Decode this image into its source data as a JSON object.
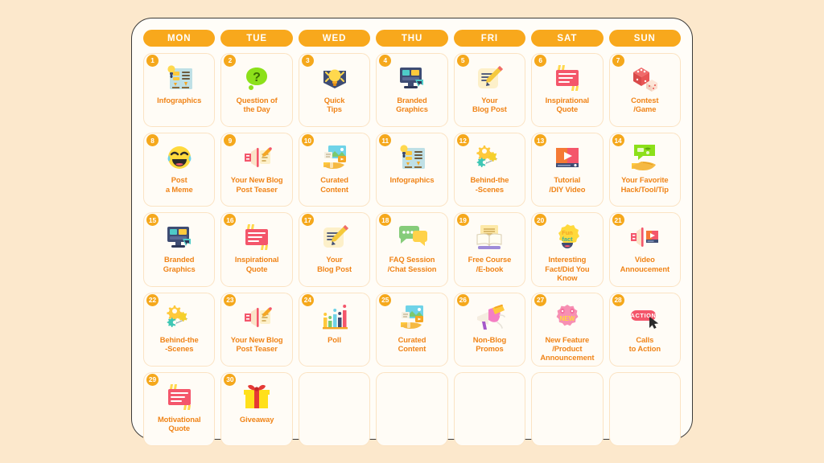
{
  "theme": {
    "page_background": "#FCE8CC",
    "panel_background": "#FFFDF8",
    "panel_border": "#3C3B39",
    "accent_orange": "#F8A81C",
    "label_orange": "#F08418",
    "cell_background": "#FFFCF6",
    "cell_border": "#FBE3C3",
    "badge_text": "#FFFFFF"
  },
  "header": {
    "days": [
      {
        "label": "MON"
      },
      {
        "label": "TUE"
      },
      {
        "label": "WED"
      },
      {
        "label": "THU"
      },
      {
        "label": "FRI"
      },
      {
        "label": "SAT"
      },
      {
        "label": "SUN"
      }
    ]
  },
  "calendar": {
    "rows": 5,
    "columns": 7,
    "total_filled": 30,
    "cells": [
      {
        "number": "1",
        "label": "Infographics",
        "icon": "infographic-board-icon",
        "empty": false
      },
      {
        "number": "2",
        "label": "Question of\nthe Day",
        "icon": "question-bubble-icon",
        "empty": false
      },
      {
        "number": "3",
        "label": "Quick\nTips",
        "icon": "lightbulb-banner-icon",
        "empty": false
      },
      {
        "number": "4",
        "label": "Branded\nGraphics",
        "icon": "desktop-monitor-icon",
        "empty": false
      },
      {
        "number": "5",
        "label": "Your\nBlog Post",
        "icon": "note-pencil-icon",
        "empty": false
      },
      {
        "number": "6",
        "label": "Inspirational\nQuote",
        "icon": "quote-card-icon",
        "empty": false
      },
      {
        "number": "7",
        "label": "Contest\n/Game",
        "icon": "dice-pair-icon",
        "empty": false
      },
      {
        "number": "8",
        "label": "Post\na Meme",
        "icon": "laughing-emoji-icon",
        "empty": false
      },
      {
        "number": "9",
        "label": "Your New Blog\nPost Teaser",
        "icon": "megaphone-note-icon",
        "empty": false
      },
      {
        "number": "10",
        "label": "Curated\nContent",
        "icon": "hand-media-icon",
        "empty": false
      },
      {
        "number": "11",
        "label": "Infographics",
        "icon": "infographic-board-icon",
        "empty": false
      },
      {
        "number": "12",
        "label": "Behind-the\n-Scenes",
        "icon": "gears-network-icon",
        "empty": false
      },
      {
        "number": "13",
        "label": "Tutorial\n/DIY Video",
        "icon": "video-player-icon",
        "empty": false
      },
      {
        "number": "14",
        "label": "Your Favorite\nHack/Tool/Tip",
        "icon": "hand-chat-icon",
        "empty": false
      },
      {
        "number": "15",
        "label": "Branded\nGraphics",
        "icon": "desktop-monitor-icon",
        "empty": false
      },
      {
        "number": "16",
        "label": "Inspirational\nQuote",
        "icon": "quote-card-icon",
        "empty": false
      },
      {
        "number": "17",
        "label": "Your\nBlog Post",
        "icon": "note-pencil-icon",
        "empty": false
      },
      {
        "number": "18",
        "label": "FAQ Session\n/Chat Session",
        "icon": "chat-bubbles-icon",
        "empty": false
      },
      {
        "number": "19",
        "label": "Free Course\n/E-book",
        "icon": "open-book-icon",
        "empty": false
      },
      {
        "number": "20",
        "label": "Interesting\nFact/Did You\nKnow",
        "icon": "fun-fact-badge-icon",
        "empty": false
      },
      {
        "number": "21",
        "label": "Video\nAnnoucement",
        "icon": "megaphone-video-icon",
        "empty": false
      },
      {
        "number": "22",
        "label": "Behind-the\n-Scenes",
        "icon": "gears-network-icon",
        "empty": false
      },
      {
        "number": "23",
        "label": "Your New Blog\nPost Teaser",
        "icon": "megaphone-note-icon",
        "empty": false
      },
      {
        "number": "24",
        "label": "Poll",
        "icon": "bar-chart-icon",
        "empty": false
      },
      {
        "number": "25",
        "label": "Curated\nContent",
        "icon": "hand-media-icon",
        "empty": false
      },
      {
        "number": "26",
        "label": "Non-Blog\nPromos",
        "icon": "promo-megaphone-icon",
        "empty": false
      },
      {
        "number": "27",
        "label": "New Feature\n/Product\nAnnouncement",
        "icon": "new-badge-icon",
        "empty": false
      },
      {
        "number": "28",
        "label": "Calls\nto Action",
        "icon": "action-button-cursor-icon",
        "empty": false
      },
      {
        "number": "29",
        "label": "Motivational\nQuote",
        "icon": "quote-card-icon",
        "empty": false
      },
      {
        "number": "30",
        "label": "Giveaway",
        "icon": "gift-box-icon",
        "empty": false
      },
      {
        "number": "",
        "label": "",
        "icon": "",
        "empty": true
      },
      {
        "number": "",
        "label": "",
        "icon": "",
        "empty": true
      },
      {
        "number": "",
        "label": "",
        "icon": "",
        "empty": true
      },
      {
        "number": "",
        "label": "",
        "icon": "",
        "empty": true
      },
      {
        "number": "",
        "label": "",
        "icon": "",
        "empty": true
      }
    ]
  }
}
